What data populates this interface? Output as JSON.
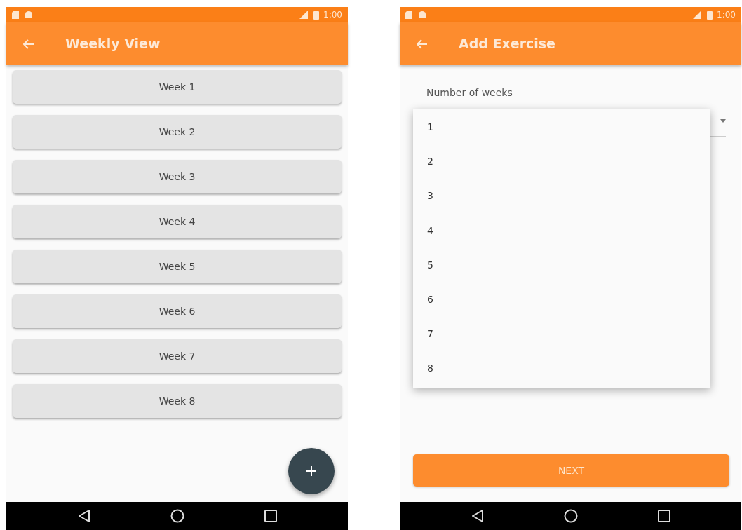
{
  "weekly_view": {
    "status_bar": {
      "time": "1:00"
    },
    "app_bar": {
      "title": "Weekly View"
    },
    "weeks": [
      "Week 1",
      "Week 2",
      "Week 3",
      "Week 4",
      "Week 5",
      "Week 6",
      "Week 7",
      "Week 8"
    ]
  },
  "add_exercise": {
    "status_bar": {
      "time": "1:00"
    },
    "app_bar": {
      "title": "Add Exercise"
    },
    "weeks_field": {
      "label": "Number of weeks",
      "expanded": true,
      "options": [
        "1",
        "2",
        "3",
        "4",
        "5",
        "6",
        "7",
        "8"
      ]
    },
    "next_button": "NEXT"
  }
}
